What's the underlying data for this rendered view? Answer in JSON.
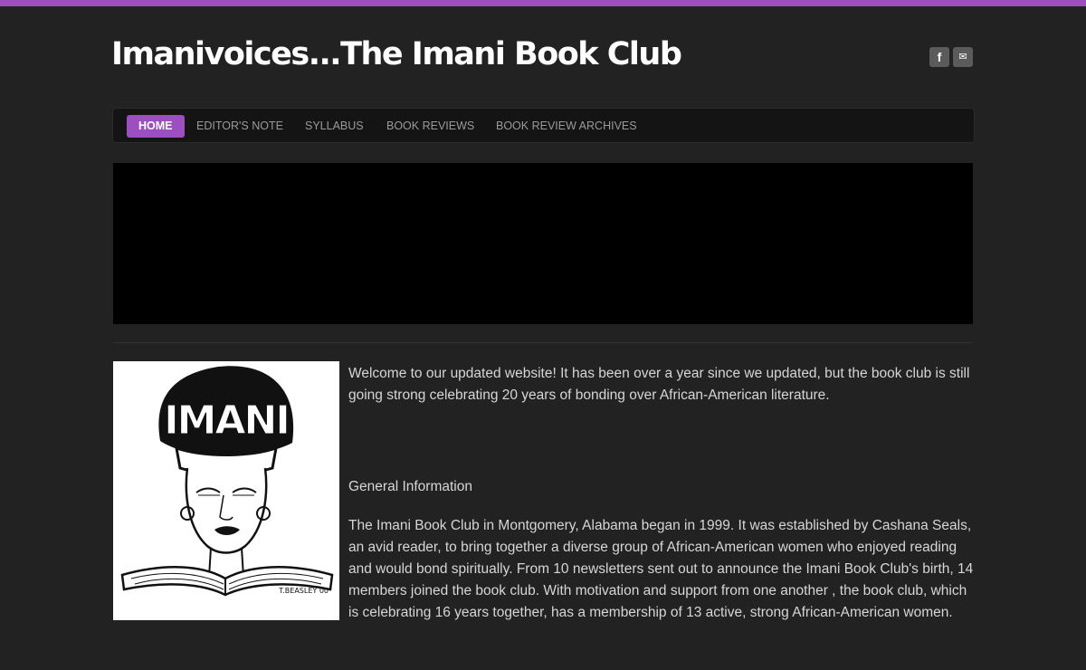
{
  "site": {
    "title": "Imanivoices...The Imani Book Club",
    "accent_color": "#9b4fc1"
  },
  "social": [
    {
      "name": "facebook-icon",
      "glyph": "f"
    },
    {
      "name": "mail-icon",
      "glyph": "✉"
    }
  ],
  "nav": {
    "items": [
      {
        "label": "HOME",
        "active": true
      },
      {
        "label": "EDITOR'S NOTE",
        "active": false
      },
      {
        "label": "SYLLABUS",
        "active": false
      },
      {
        "label": "BOOK REVIEWS",
        "active": false
      },
      {
        "label": "BOOK REVIEW ARCHIVES",
        "active": false
      }
    ]
  },
  "content": {
    "image_signature": "T.BEASLEY 00",
    "image_header_word": "IMANI",
    "welcome": "Welcome to our updated website!  It has been over a year since we updated, but the book club is still going strong celebrating 20 years of bonding over African-American literature.",
    "section_heading": "General Information",
    "body": "The Imani Book Club in Montgomery, Alabama began in 1999.  It was established by Cashana Seals, an avid reader, to bring together a diverse group of African-American women who enjoyed reading and would bond spiritually.  From 10 newsletters sent out to announce the Imani Book Club's birth, 14 members joined the book club.  With motivation and support from one another , the book club, which is celebrating 16 years together, has a membership of 13 active, strong African-American women."
  }
}
